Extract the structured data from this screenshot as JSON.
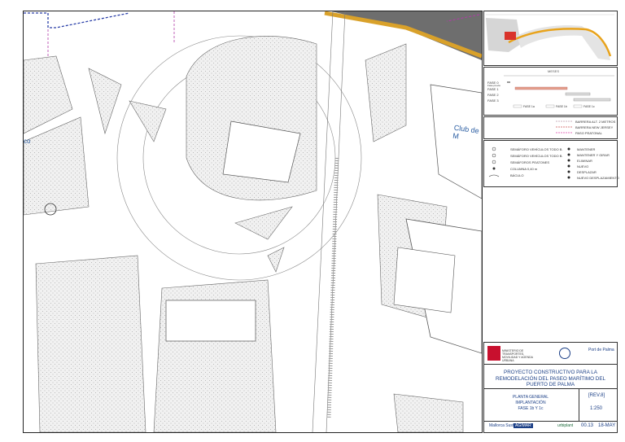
{
  "drawing": {
    "label_club": "Club de M",
    "label_co": "co"
  },
  "schedule": {
    "title": "MESES",
    "months": [
      "1",
      "2",
      "3",
      "4",
      "5",
      "6",
      "7",
      "8",
      "9",
      "10",
      "11",
      "12",
      "13",
      "14",
      "15",
      "16",
      "17",
      "18",
      "19",
      "20"
    ],
    "phases": [
      "FASE 0",
      "FASE 1",
      "FASE 2",
      "FASE 3"
    ],
    "phase0_sub": "Fase previa",
    "keys": [
      "FASE 1a",
      "FASE 1b",
      "FASE 1c"
    ]
  },
  "legend_lines": [
    "BARRERA ALT. 2 METROS",
    "BARRERA NEW JERSEY",
    "PASO PEATONAL"
  ],
  "legend_symbols": {
    "left": [
      "SEMÁFORO VEHÍCULOS TODO B.",
      "SEMÁFORO VEHÍCULOS TODO B.",
      "SEMÁFOROS PEATONES",
      "COLUMNA 0,40 m",
      "BÁCULO"
    ],
    "right": [
      "MANTENER",
      "MANTENER Y GIRAR",
      "ELIMINAR",
      "NUEVO",
      "DESPLAZAR",
      "NUEVO DESPLAZAMIENTO"
    ]
  },
  "title_block": {
    "org_left": "MINISTERIO DE TRANSPORTES, MOVILIDAD Y AGENDA URBANA",
    "org_right": "Port de Palma",
    "project": "PROYECTO CONSTRUCTIVO PARA LA REMODELACIÓN DEL PASEO MARÍTIMO DEL PUERTO DE PALMA",
    "plan_title": "PLANTA GENERAL",
    "plan_sub1": "IMPLANTACIÓN",
    "plan_sub2": "FASE 1b Y 1c",
    "rev": "[REV.8]",
    "scale": "1:250",
    "sheet_no": "00.13",
    "date": "18-MAY",
    "logos": [
      "urbiplant",
      "AGIMAR",
      "Mallorca Sustainable"
    ]
  },
  "colors": {
    "road_yellow": "#d9a12a",
    "road_gray": "#6e6e6e",
    "accent_blue": "#1b3f86",
    "purple": "#b23aa8",
    "hatch": "#bdbdbd"
  }
}
